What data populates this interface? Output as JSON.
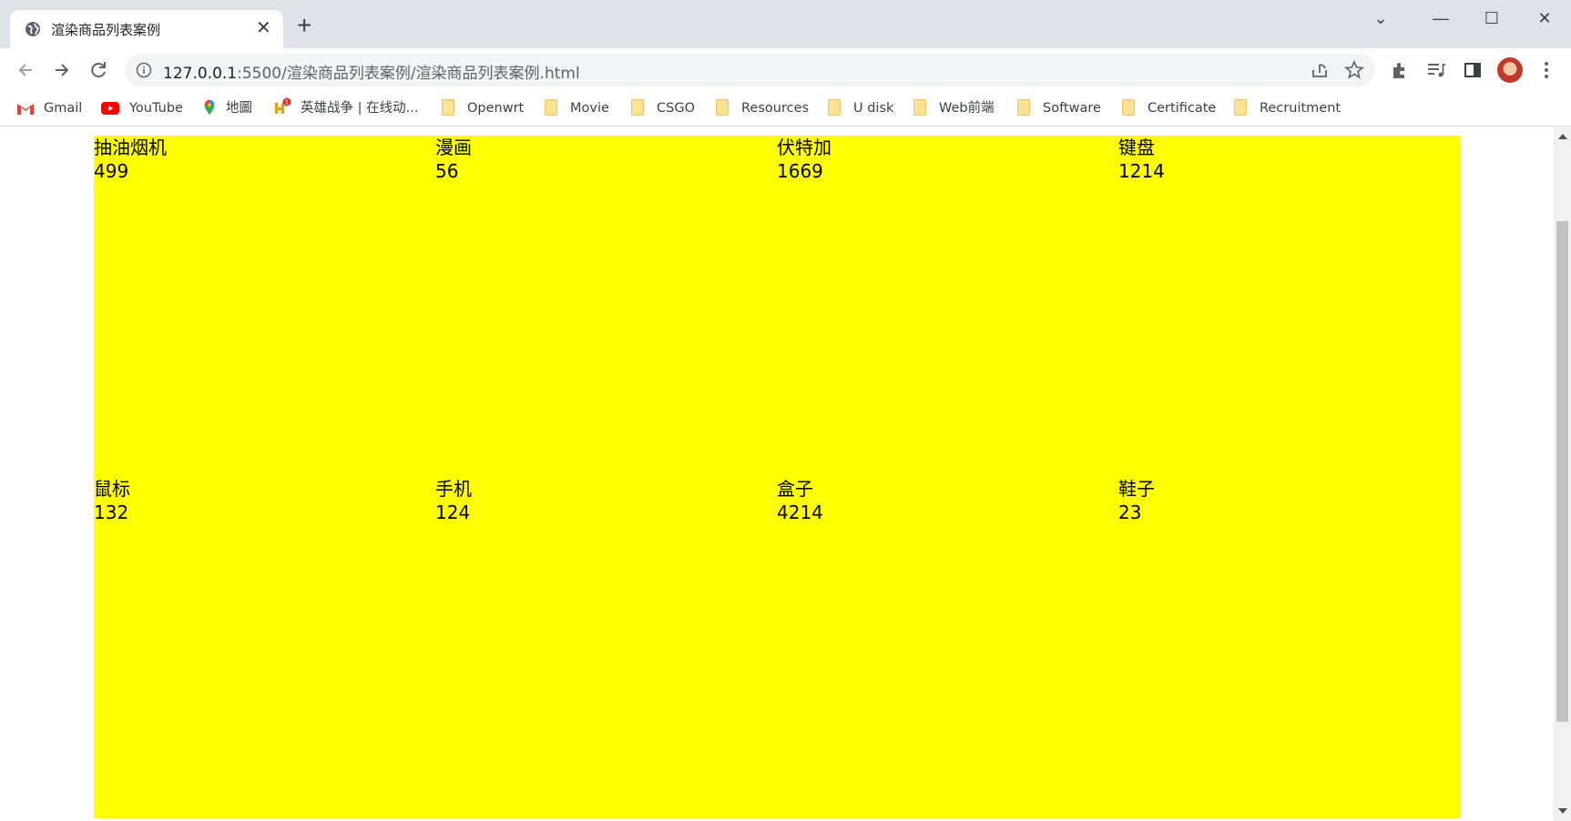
{
  "browser": {
    "tab": {
      "title": "渲染商品列表案例",
      "favicon": "globe-icon",
      "close_glyph": "✕"
    },
    "newtab_glyph": "+",
    "window_controls": {
      "dropdown": "⌄",
      "minimize": "—",
      "maximize": "☐",
      "close": "✕"
    },
    "omnibox": {
      "host": "127.0.0.1",
      "rest": ":5500/渲染商品列表案例/渲染商品列表案例.html"
    },
    "bookmarks": [
      {
        "label": "Gmail",
        "icon": "gmail-icon"
      },
      {
        "label": "YouTube",
        "icon": "youtube-icon"
      },
      {
        "label": "地圖",
        "icon": "maps-icon"
      },
      {
        "label": "英雄战争 | 在线动...",
        "icon": "game-icon"
      },
      {
        "label": "Openwrt",
        "icon": "folder-icon"
      },
      {
        "label": "Movie",
        "icon": "folder-icon"
      },
      {
        "label": "CSGO",
        "icon": "folder-icon"
      },
      {
        "label": "Resources",
        "icon": "folder-icon"
      },
      {
        "label": "U disk",
        "icon": "folder-icon"
      },
      {
        "label": "Web前端",
        "icon": "folder-icon"
      },
      {
        "label": "Software",
        "icon": "folder-icon"
      },
      {
        "label": "Certificate",
        "icon": "folder-icon"
      },
      {
        "label": "Recruitment",
        "icon": "folder-icon"
      }
    ]
  },
  "page": {
    "background": "#ffff00",
    "goods": [
      {
        "name": "抽油烟机",
        "price": "499"
      },
      {
        "name": "漫画",
        "price": "56"
      },
      {
        "name": "伏特加",
        "price": "1669"
      },
      {
        "name": "键盘",
        "price": "1214"
      },
      {
        "name": "鼠标",
        "price": "132"
      },
      {
        "name": "手机",
        "price": "124"
      },
      {
        "name": "盒子",
        "price": "4214"
      },
      {
        "name": "鞋子",
        "price": "23"
      }
    ]
  }
}
